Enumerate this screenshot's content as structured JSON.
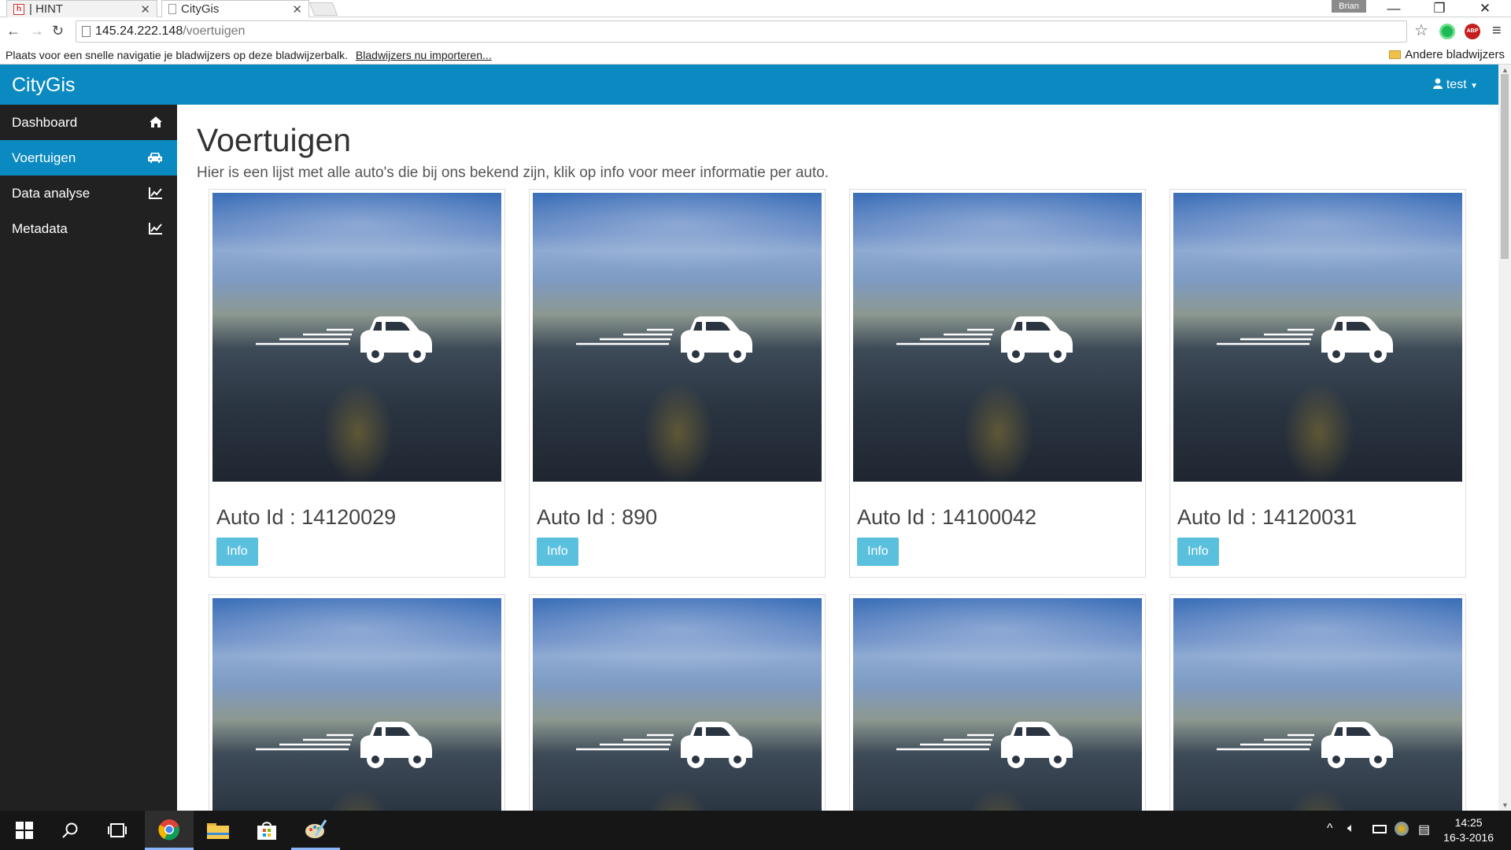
{
  "browser": {
    "tabs": [
      {
        "label": "| HINT",
        "favicon": "h"
      },
      {
        "label": "CityGis",
        "favicon": "page"
      }
    ],
    "user_badge": "Brian",
    "address_host": "145.24.222.148",
    "address_path": "/voertuigen",
    "bookmarks_bar_text": "Plaats voor een snelle navigatie je bladwijzers op deze bladwijzerbalk.",
    "bookmarks_import_link": "Bladwijzers nu importeren...",
    "other_bookmarks": "Andere bladwijzers"
  },
  "app": {
    "brand": "CityGis",
    "user_label": "test",
    "sidebar": [
      {
        "label": "Dashboard",
        "icon": "home-icon",
        "active": false
      },
      {
        "label": "Voertuigen",
        "icon": "car-icon",
        "active": true
      },
      {
        "label": "Data analyse",
        "icon": "line-chart-icon",
        "active": false
      },
      {
        "label": "Metadata",
        "icon": "line-chart-icon",
        "active": false
      }
    ],
    "page_title": "Voertuigen",
    "page_subtitle": "Hier is een lijst met alle auto's die bij ons bekend zijn, klik op info voor meer informatie per auto.",
    "info_button": "Info",
    "cars": [
      {
        "caption": "Auto Id : 14120029"
      },
      {
        "caption": "Auto Id : 890"
      },
      {
        "caption": "Auto Id : 14100042"
      },
      {
        "caption": "Auto Id : 14120031"
      }
    ],
    "accent_color": "#0a8ac0",
    "button_color": "#5bc0de"
  },
  "taskbar": {
    "time": "14:25",
    "date": "16-3-2016"
  }
}
